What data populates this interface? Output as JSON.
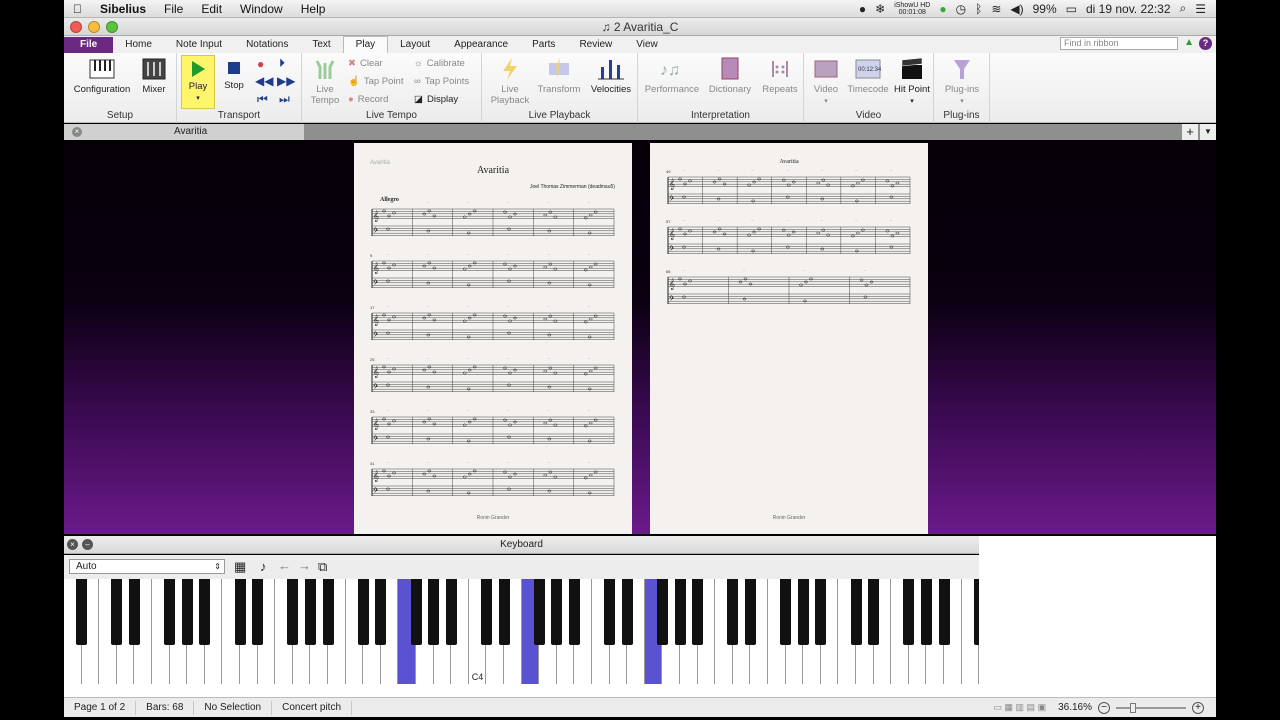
{
  "menubar": {
    "app": "Sibelius",
    "items": [
      "File",
      "Edit",
      "Window",
      "Help"
    ],
    "battery": "99%",
    "datetime": "di 19 nov.  22:32",
    "ishowu": "iShowU HD",
    "ishowu_time": "00:01:08"
  },
  "window": {
    "title": "2 Avaritia_C"
  },
  "ribbon_tabs": [
    "File",
    "Home",
    "Note Input",
    "Notations",
    "Text",
    "Play",
    "Layout",
    "Appearance",
    "Parts",
    "Review",
    "View"
  ],
  "ribbon_search_placeholder": "Find in ribbon",
  "ribbon": {
    "setup": {
      "label": "Setup",
      "configuration": "Configuration",
      "mixer": "Mixer"
    },
    "transport": {
      "label": "Transport",
      "play": "Play",
      "stop": "Stop"
    },
    "live_tempo": {
      "label": "Live Tempo",
      "live_tempo_btn": "Live Tempo",
      "clear": "Clear",
      "tap_point": "Tap Point",
      "record": "Record",
      "calibrate": "Calibrate",
      "tap_points": "Tap Points",
      "display": "Display"
    },
    "live_playback": {
      "label": "Live Playback",
      "live_playback_btn": "Live Playback",
      "transform": "Transform",
      "velocities": "Velocities"
    },
    "interpretation": {
      "label": "Interpretation",
      "performance": "Performance",
      "dictionary": "Dictionary",
      "repeats": "Repeats"
    },
    "video": {
      "label": "Video",
      "video_btn": "Video",
      "timecode": "Timecode",
      "hit_point": "Hit Point"
    },
    "plugins": {
      "label": "Plug-ins",
      "plugins_btn": "Plug-ins"
    }
  },
  "document_tab": "Avaritia",
  "score": {
    "title": "Avaritia",
    "header_small": "Avaritia",
    "composer": "Joel Thomas Zimmerman (deadmau5)",
    "tempo": "Allegro",
    "footer": "Ronin Grander",
    "page2_header": "Avaritia",
    "bar_numbers_p1": [
      "9",
      "17",
      "25",
      "33",
      "41"
    ],
    "bar_numbers_p2": [
      "49",
      "57",
      "65"
    ]
  },
  "keyboard": {
    "title": "Keyboard",
    "mode": "Auto",
    "c4_label": "C4"
  },
  "status": {
    "page": "Page 1 of 2",
    "bars": "Bars: 68",
    "selection": "No Selection",
    "pitch": "Concert pitch",
    "zoom": "36.16%"
  },
  "colors": {
    "file_tab": "#6b2a7f",
    "play_highlight": "#fff56b",
    "key_highlight": "#5a52d0"
  }
}
